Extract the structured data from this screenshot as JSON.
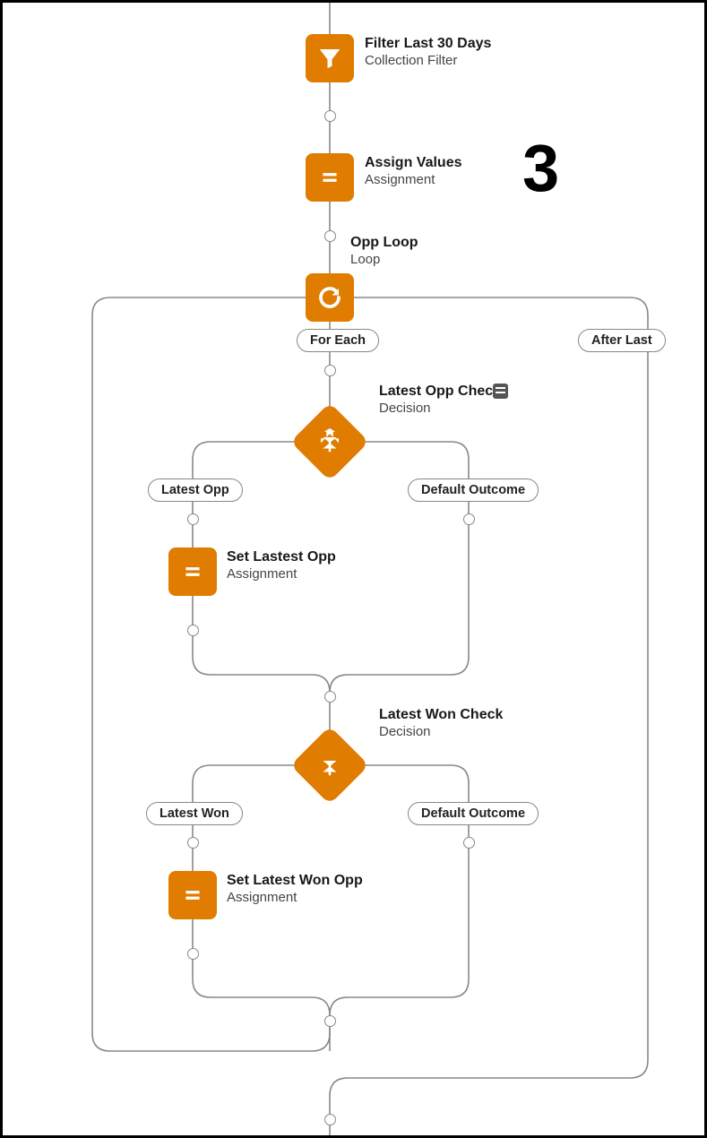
{
  "annotation": "3",
  "nodes": {
    "filter": {
      "title": "Filter Last 30 Days",
      "subtitle": "Collection Filter"
    },
    "assign_values": {
      "title": "Assign Values",
      "subtitle": "Assignment"
    },
    "opp_loop": {
      "title": "Opp Loop",
      "subtitle": "Loop"
    },
    "latest_opp_check": {
      "title": "Latest Opp Check",
      "subtitle": "Decision"
    },
    "set_latest_opp": {
      "title": "Set Lastest Opp",
      "subtitle": "Assignment"
    },
    "latest_won_check": {
      "title": "Latest Won Check",
      "subtitle": "Decision"
    },
    "set_latest_won": {
      "title": "Set Latest Won Opp",
      "subtitle": "Assignment"
    }
  },
  "pills": {
    "for_each": "For Each",
    "after_last": "After Last",
    "latest_opp": "Latest Opp",
    "default_outcome_1": "Default Outcome",
    "latest_won": "Latest Won",
    "default_outcome_2": "Default Outcome"
  }
}
